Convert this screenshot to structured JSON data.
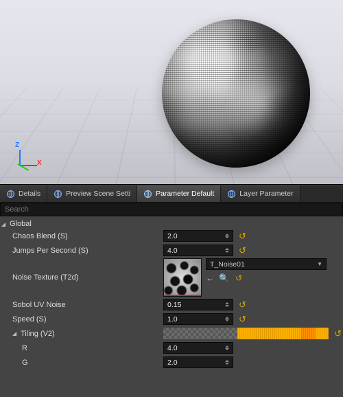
{
  "viewport": {
    "gizmo": {
      "z": "Z",
      "x": "X"
    }
  },
  "tabs": {
    "items": [
      {
        "label": "Details",
        "active": false
      },
      {
        "label": "Preview Scene Setti",
        "active": false
      },
      {
        "label": "Parameter Default",
        "active": true
      },
      {
        "label": "Layer Parameter",
        "active": false
      }
    ]
  },
  "search": {
    "placeholder": "Search"
  },
  "group": {
    "label": "Global"
  },
  "params": {
    "chaos_blend": {
      "label": "Chaos Blend (S)",
      "value": "2.0"
    },
    "jumps_per_second": {
      "label": "Jumps Per Second (S)",
      "value": "4.0"
    },
    "noise_texture": {
      "label": "Noise Texture (T2d)",
      "asset": "T_Noise01"
    },
    "sobol_uv_noise": {
      "label": "Sobol UV Noise",
      "value": "0.15"
    },
    "speed": {
      "label": "Speed (S)",
      "value": "1.0"
    },
    "tiling": {
      "label": "Tiling (V2)",
      "r": {
        "label": "R",
        "value": "4.0"
      },
      "g": {
        "label": "G",
        "value": "2.0"
      }
    }
  },
  "icons": {
    "reset": "↺",
    "arrow_left": "←",
    "search": "🔍",
    "dropdown": "▼"
  }
}
